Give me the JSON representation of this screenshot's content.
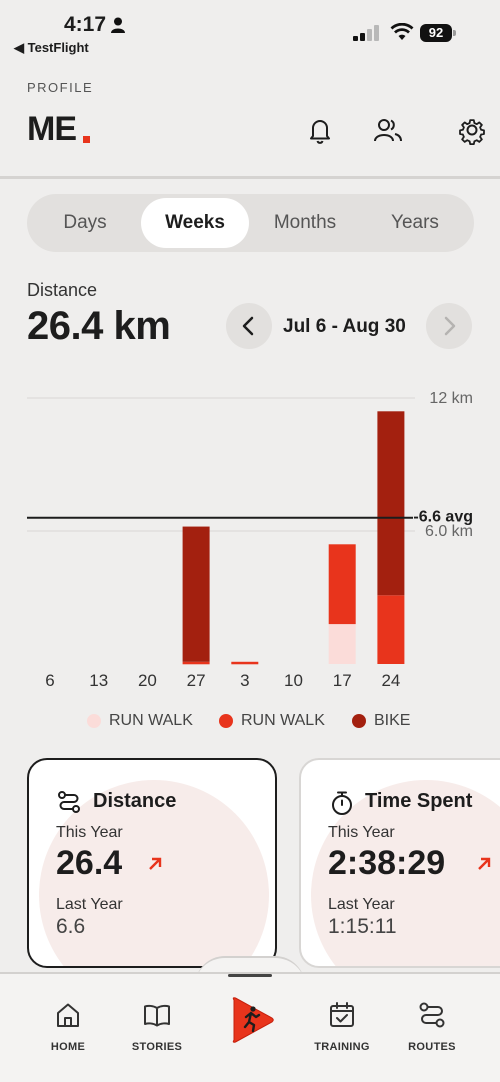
{
  "status_bar": {
    "time": "4:17",
    "back_label": "◀ TestFlight",
    "battery": "92"
  },
  "header": {
    "section": "PROFILE",
    "brand": "ME",
    "icons": [
      "bell-icon",
      "friends-icon",
      "gear-icon"
    ]
  },
  "period_tabs": [
    "Days",
    "Weeks",
    "Months",
    "Years"
  ],
  "selected_period": "Weeks",
  "metric": {
    "label": "Distance",
    "value": "26.4 km",
    "date_range": "Jul 6 - Aug 30"
  },
  "colors": {
    "accent": "#e8341c",
    "run_walk_light": "#fbdcd9",
    "run_walk": "#e8341c",
    "bike": "#a3200f"
  },
  "chart_data": {
    "type": "bar",
    "stacked": true,
    "categories": [
      "6",
      "13",
      "20",
      "27",
      "3",
      "10",
      "17",
      "24"
    ],
    "series": [
      {
        "name": "RUN WALK",
        "color": "#fbdcd9",
        "values": [
          0,
          0,
          0,
          0,
          0,
          0,
          1.8,
          0
        ]
      },
      {
        "name": "RUN WALK",
        "color": "#e8341c",
        "values": [
          0,
          0,
          0,
          0.1,
          0.1,
          0,
          3.6,
          3.1
        ]
      },
      {
        "name": "BIKE",
        "color": "#a3200f",
        "values": [
          0,
          0,
          0,
          6.1,
          0,
          0,
          0,
          8.3
        ]
      }
    ],
    "yticks": [
      {
        "value": 12,
        "label": "12 km"
      },
      {
        "value": 6,
        "label": "6.0 km"
      }
    ],
    "average": {
      "value": 6.6,
      "label": "6.6 avg"
    },
    "ylim": [
      0,
      12.5
    ],
    "legend_position": "bottom"
  },
  "cards": [
    {
      "title": "Distance",
      "icon": "route-icon",
      "this_year_label": "This Year",
      "this_year_value": "26.4",
      "last_year_label": "Last Year",
      "last_year_value": "6.6"
    },
    {
      "title": "Time Spent",
      "icon": "stopwatch-icon",
      "this_year_label": "This Year",
      "this_year_value": "2:38:29",
      "last_year_label": "Last Year",
      "last_year_value": "1:15:11"
    }
  ],
  "tabbar": {
    "home": "HOME",
    "stories": "STORIES",
    "training": "TRAINING",
    "routes": "ROUTES"
  }
}
